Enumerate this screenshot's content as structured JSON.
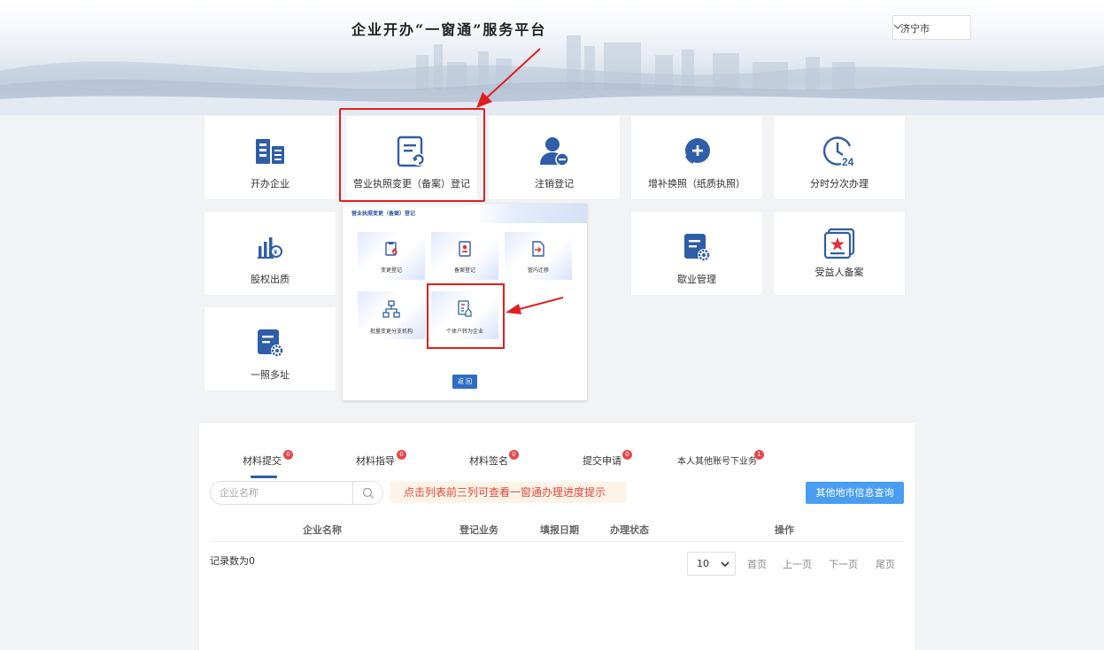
{
  "header": {
    "title": "企业开办“一窗通”服务平台",
    "city": "济宁市"
  },
  "services": [
    {
      "label": "开办企业",
      "icon": "building-icon"
    },
    {
      "label": "营业执照变更（备案）登记",
      "icon": "document-refresh-icon"
    },
    {
      "label": "注销登记",
      "icon": "user-remove-icon"
    },
    {
      "label": "增补换照（纸质执照）",
      "icon": "plus-circle-icon"
    },
    {
      "label": "分时分次办理",
      "icon": "clock-24-icon"
    },
    {
      "label": "股权出质",
      "icon": "equity-chart-icon"
    },
    {
      "label": "歇业管理",
      "icon": "document-gear-icon"
    },
    {
      "label": "受益人备案",
      "icon": "star-certificate-icon"
    },
    {
      "label": "一照多址",
      "icon": "document-gear-icon"
    }
  ],
  "popup": {
    "title": "营业执照变更（备案）登记",
    "items": [
      {
        "label": "变更登记",
        "icon": "clipboard-edit-icon"
      },
      {
        "label": "备案登记",
        "icon": "id-card-icon"
      },
      {
        "label": "管内迁移",
        "icon": "file-move-icon"
      },
      {
        "label": "批量变更分支机构",
        "icon": "org-chart-icon"
      },
      {
        "label": "个体户转为企业",
        "icon": "document-convert-icon"
      }
    ],
    "back_label": "返 回"
  },
  "panel": {
    "tabs": [
      {
        "label": "材料提交",
        "count": "0"
      },
      {
        "label": "材料指导",
        "count": "0"
      },
      {
        "label": "材料签名",
        "count": "0"
      },
      {
        "label": "提交申请",
        "count": "0"
      },
      {
        "label": "本人其他账号下业务",
        "count": "1"
      }
    ],
    "search_placeholder": "企业名称",
    "notice": "点击列表前三列可查看一窗通办理进度提示",
    "other_button": "其他地市信息查询",
    "columns": [
      "企业名称",
      "登记业务",
      "填报日期",
      "办理状态",
      "操作"
    ],
    "record_count": "记录数为0",
    "page_size": "10",
    "pagination": [
      "首页",
      "上一页",
      "下一页",
      "尾页"
    ]
  },
  "colors": {
    "primary_icon": "#2f5ea8",
    "highlight": "#e02020",
    "badge": "#e6484c",
    "button": "#4a9ef1",
    "notice_text": "#e0483e",
    "notice_bg": "#fdf3e7"
  }
}
